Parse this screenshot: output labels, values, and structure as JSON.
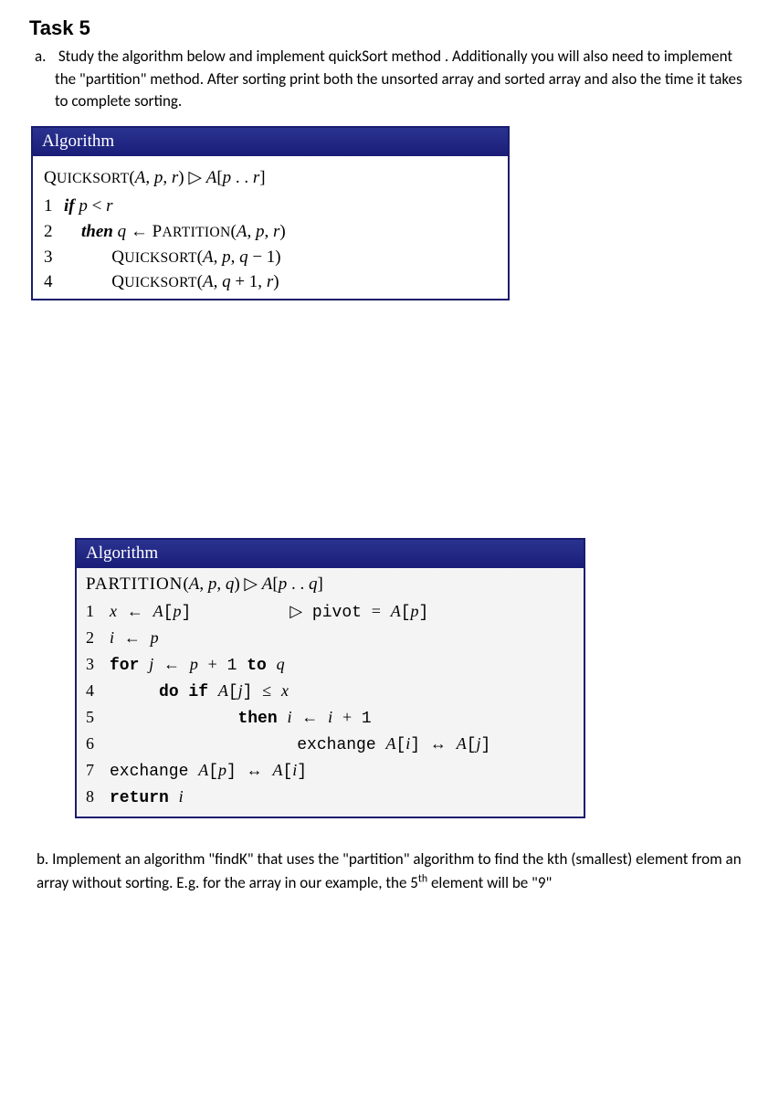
{
  "task": {
    "title": "Task 5",
    "part_a": {
      "marker": "a.",
      "text": "Study the algorithm below and implement quickSort method . Additionally you will also need to implement the \"partition\" method. After sorting print both the unsorted array and sorted array and also the time it takes to complete sorting."
    },
    "part_b": {
      "marker": "b.",
      "text_pre": "Implement an algorithm \"findK\" that uses the \"partition\" algorithm to find the kth (smallest) element from an array without sorting. E.g. for the array in our example, the 5",
      "sup": "th",
      "text_post": " element will be \"9\""
    }
  },
  "algo1": {
    "header": "Algorithm",
    "signature_name": "Quicksort",
    "signature_args": "(A, p, r)",
    "signature_tail": " ▷ A[p . . r]",
    "lines": [
      {
        "n": "1",
        "code": "if p < r"
      },
      {
        "n": "2",
        "code": "then q ← Partition(A, p, r)"
      },
      {
        "n": "3",
        "code": "Quicksort(A, p, q − 1)"
      },
      {
        "n": "4",
        "code": "Quicksort(A, q + 1, r)"
      }
    ]
  },
  "algo2": {
    "header": "Algorithm",
    "signature_name": "Partition",
    "signature_args": "(A, p, q)",
    "signature_tail": " ▷ A[p . . q]",
    "lines": [
      {
        "n": "1",
        "code": "x ← A[p]          ▷ pivot = A[p]"
      },
      {
        "n": "2",
        "code": "i ← p"
      },
      {
        "n": "3",
        "code": "for j ← p + 1 to q"
      },
      {
        "n": "4",
        "code": "     do if A[j] ≤ x"
      },
      {
        "n": "5",
        "code": "             then i ← i + 1"
      },
      {
        "n": "6",
        "code": "                   exchange A[i] ↔ A[j]"
      },
      {
        "n": "7",
        "code": "exchange A[p] ↔ A[i]"
      },
      {
        "n": "8",
        "code": "return i"
      }
    ]
  }
}
